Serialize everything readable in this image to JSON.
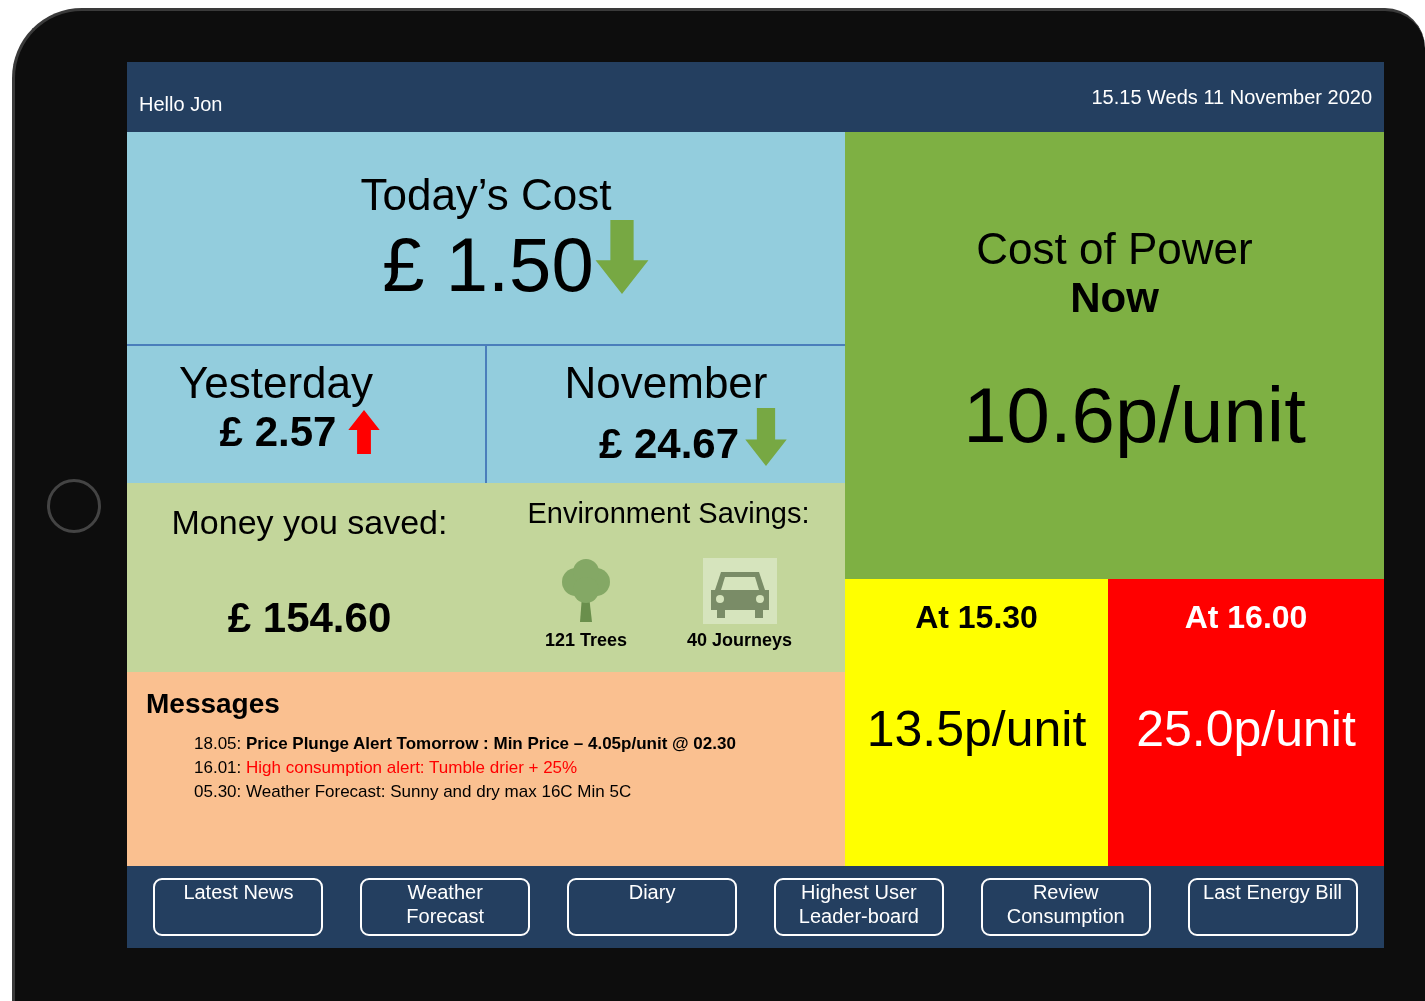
{
  "header": {
    "greeting": "Hello Jon",
    "datetime": "15.15 Weds 11 November 2020"
  },
  "today": {
    "title": "Today’s Cost",
    "amount": "£ 1.50",
    "rising": false
  },
  "periods": [
    {
      "label": "Yesterday",
      "amount": "£ 2.57",
      "rising": true
    },
    {
      "label": "November",
      "amount": "£ 24.67",
      "rising": false
    }
  ],
  "savings": {
    "title": "Money you saved:",
    "amount": "£ 154.60",
    "environment_title": "Environment Savings:",
    "items": [
      {
        "kind": "tree",
        "label": "121 Trees"
      },
      {
        "kind": "car",
        "label": "40 Journeys"
      }
    ]
  },
  "messages": {
    "title": "Messages",
    "items": [
      {
        "time": "18.05:",
        "text": "Price Plunge Alert Tomorrow : Min Price – 4.05p/unit @ 02.30",
        "kind": "highlight"
      },
      {
        "time": "16.01:",
        "text": "High consumption alert: Tumble drier + 25%",
        "kind": "alert"
      },
      {
        "time": "05.30:",
        "text": "Weather Forecast: Sunny and dry max 16C Min 5C",
        "kind": "info"
      }
    ]
  },
  "power_now": {
    "title": "Cost of Power",
    "subtitle": "Now",
    "price": "10.6p/unit"
  },
  "forecasts": [
    {
      "time": "At 15.30",
      "price": "13.5p/unit",
      "color": "#ffff00"
    },
    {
      "time": "At 16.00",
      "price": "25.0p/unit",
      "color": "#ff0000"
    }
  ],
  "nav_buttons": [
    "Latest News",
    "Weather Forecast",
    "Diary",
    "Highest User Leader-board",
    "Review Consumption",
    "Last Energy Bill"
  ]
}
